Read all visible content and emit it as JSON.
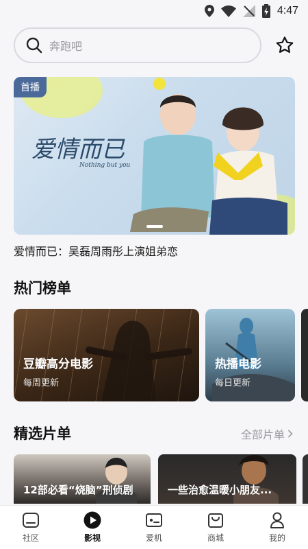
{
  "status": {
    "time": "4:47"
  },
  "search": {
    "placeholder": "奔跑吧"
  },
  "banner": {
    "badge": "首播",
    "caption": "爱情而已：吴磊周雨彤上演姐弟恋",
    "logo_text": "爱情而已",
    "logo_sub": "Nothing but you"
  },
  "hot": {
    "title": "热门榜单",
    "cards": [
      {
        "title": "豆瓣高分电影",
        "subtitle": "每周更新"
      },
      {
        "title": "热播电影",
        "subtitle": "每日更新"
      }
    ]
  },
  "picks": {
    "title": "精选片单",
    "more": "全部片单",
    "cards": [
      {
        "title": "12部必看“烧脑”刑侦剧"
      },
      {
        "title": "一些治愈温暖小朋友..."
      }
    ]
  },
  "nav": {
    "items": [
      {
        "label": "社区",
        "icon": "home-icon"
      },
      {
        "label": "影视",
        "icon": "play-icon",
        "active": true
      },
      {
        "label": "爱机",
        "icon": "device-icon"
      },
      {
        "label": "商城",
        "icon": "shop-bag-icon"
      },
      {
        "label": "我的",
        "icon": "person-icon"
      }
    ]
  },
  "colors": {
    "accent": "#111111",
    "badge": "#4b6a9a"
  }
}
